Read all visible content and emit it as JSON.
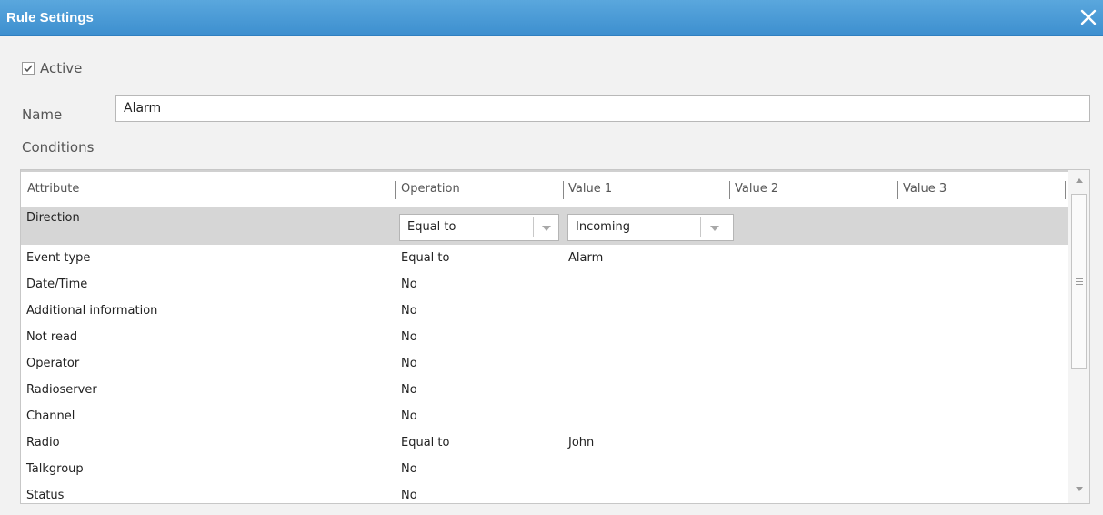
{
  "window": {
    "title": "Rule Settings",
    "close_icon": "close-icon",
    "accent": "#3d8fcf"
  },
  "form": {
    "active_label": "Active",
    "active_checked": true,
    "name_label": "Name",
    "name_value": "Alarm",
    "conditions_label": "Conditions"
  },
  "grid": {
    "columns": [
      "Attribute",
      "Operation",
      "Value 1",
      "Value 2",
      "Value 3"
    ],
    "selected_row": {
      "attribute": "Direction",
      "operation": "Equal to",
      "value1": "Incoming"
    },
    "rows": [
      {
        "attribute": "Event type",
        "operation": "Equal to",
        "value1": "Alarm"
      },
      {
        "attribute": "Date/Time",
        "operation": "No",
        "value1": ""
      },
      {
        "attribute": "Additional information",
        "operation": "No",
        "value1": ""
      },
      {
        "attribute": "Not read",
        "operation": "No",
        "value1": ""
      },
      {
        "attribute": "Operator",
        "operation": "No",
        "value1": ""
      },
      {
        "attribute": "Radioserver",
        "operation": "No",
        "value1": ""
      },
      {
        "attribute": "Channel",
        "operation": "No",
        "value1": ""
      },
      {
        "attribute": "Radio",
        "operation": "Equal to",
        "value1": "John"
      },
      {
        "attribute": "Talkgroup",
        "operation": "No",
        "value1": ""
      },
      {
        "attribute": "Status",
        "operation": "No",
        "value1": ""
      }
    ]
  }
}
